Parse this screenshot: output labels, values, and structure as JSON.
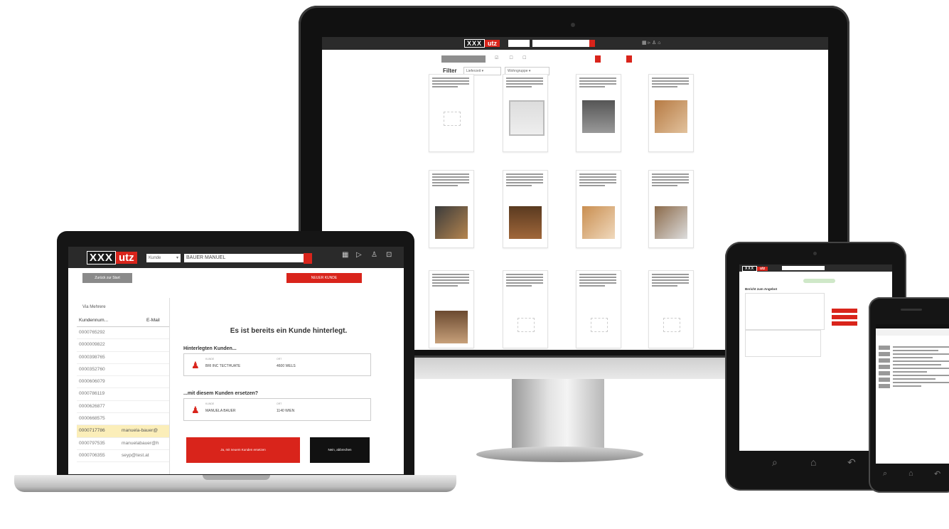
{
  "brand": {
    "logo_part1": "XXX",
    "logo_part2": "utz",
    "accent": "#d9241b",
    "dark": "#1a1a1a"
  },
  "laptop": {
    "search_select": "Kunde",
    "search_value": "BAUER MANUEL",
    "back_button": "Zurück zur Start",
    "new_customer_button": "NEUER KUNDE",
    "list_header": "Via Mehrere",
    "columns": [
      "Kundennum...",
      "E-Mail"
    ],
    "rows": [
      {
        "id": "0000765292",
        "email": ""
      },
      {
        "id": "0000009822",
        "email": ""
      },
      {
        "id": "0000398765",
        "email": ""
      },
      {
        "id": "0000352760",
        "email": ""
      },
      {
        "id": "0000606079",
        "email": ""
      },
      {
        "id": "0000786119",
        "email": ""
      },
      {
        "id": "0000626877",
        "email": ""
      },
      {
        "id": "0000668575",
        "email": ""
      },
      {
        "id": "0000717786",
        "email": "manuela-bauer@"
      },
      {
        "id": "0000797535",
        "email": "manuelabauer@h"
      },
      {
        "id": "0000706355",
        "email": "seyp@test.at"
      }
    ],
    "selected_row_index": 8,
    "dialog_title": "Es ist bereits ein Kunde hinterlegt.",
    "section1_title": "Hinterlegten Kunden...",
    "customer1": {
      "label_name": "KUNDE",
      "name": "BRI INC TECTHUATE",
      "label_city": "ORT",
      "city": "4600 WELS"
    },
    "section2_title": "...mit diesem Kunden ersetzen?",
    "customer2": {
      "label_name": "KUNDE",
      "name": "MANUELA BAUER",
      "label_city": "ORT",
      "city": "1140 WIEN"
    },
    "confirm_button": "Ja, mit neuem Kunden ersetzen",
    "cancel_button": "Nein, abbrechen"
  },
  "monitor": {
    "filter_label": "Filter",
    "filter_select1": "Lieferzeit",
    "filter_select2": "Wohngruppe"
  },
  "tablet": {
    "title": "Bericht zum Angebot"
  }
}
